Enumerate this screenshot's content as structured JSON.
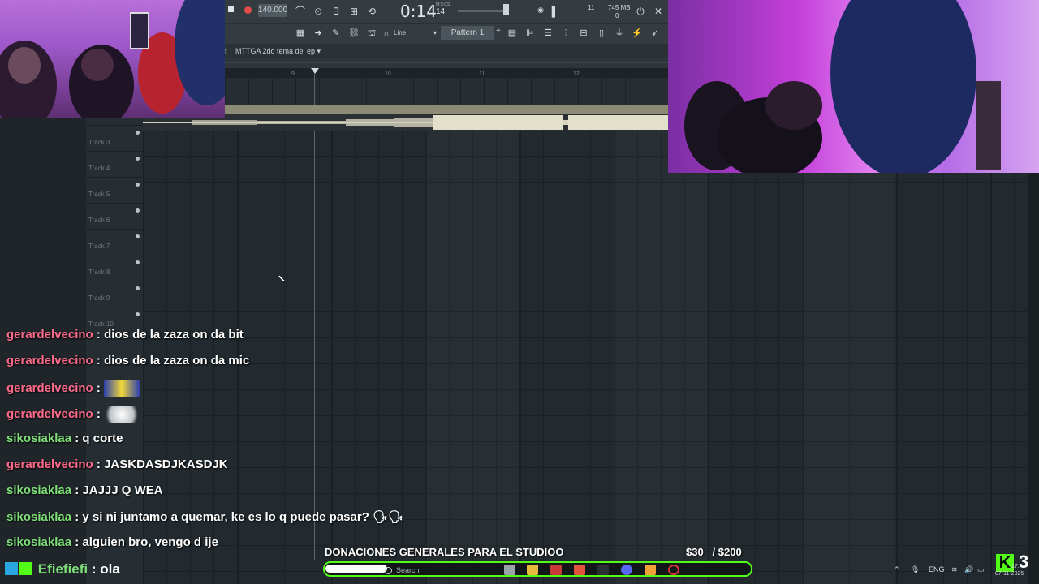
{
  "app": {
    "project_title": "MTTGA 2do tema del ep",
    "tempo": "140.000",
    "time_main": "0:14",
    "time_sub": "14",
    "time_label": "M:S:CS",
    "cpu": "11",
    "memory": "745 MB",
    "poly": "0",
    "snap": "Line",
    "pattern": "Pattern 1"
  },
  "ruler": [
    "9",
    "10",
    "11",
    "12"
  ],
  "tracks": [
    "Track 3",
    "Track 4",
    "Track 5",
    "Track 6",
    "Track 7",
    "Track 8",
    "Track 9",
    "Track 10"
  ],
  "chat": [
    {
      "user": "gerardelvecino",
      "color": "#ff6b8b",
      "message": "dios de la zaza on da bit"
    },
    {
      "user": "gerardelvecino",
      "color": "#ff6b8b",
      "message": "dios de la zaza on da mic"
    },
    {
      "user": "gerardelvecino",
      "color": "#ff6b8b",
      "message": "",
      "emote": "minion-emote"
    },
    {
      "user": "gerardelvecino",
      "color": "#ff6b8b",
      "message": "",
      "emote": "smoke-emote"
    },
    {
      "user": "sikosiaklaa",
      "color": "#7fe07a",
      "message": "q corte"
    },
    {
      "user": "gerardelvecino",
      "color": "#ff6b8b",
      "message": "JASKDASDJKASDJK"
    },
    {
      "user": "sikosiaklaa",
      "color": "#7fe07a",
      "message": "JAJJJ Q WEA"
    },
    {
      "user": "sikosiaklaa",
      "color": "#7fe07a",
      "message": "y si ni juntamo a quemar, ke es lo q puede pasar? 🗣🗣"
    },
    {
      "user": "sikosiaklaa",
      "color": "#7fe07a",
      "message": "alguien bro, vengo d ije"
    }
  ],
  "kick_chat": {
    "user": "Efiefiefi",
    "color": "#7fe07a",
    "message": "ola"
  },
  "donation": {
    "label": "DONACIONES GENERALES PARA EL STUDIOO",
    "current": "$30",
    "goal": "/ $200"
  },
  "taskbar": {
    "search_placeholder": "Search",
    "lang": "ENG",
    "time": "17:",
    "date": "07-11-2025"
  },
  "viewers": "3",
  "colors": {
    "kick_green": "#53fc18",
    "accent_purple": "#c33fd8"
  }
}
